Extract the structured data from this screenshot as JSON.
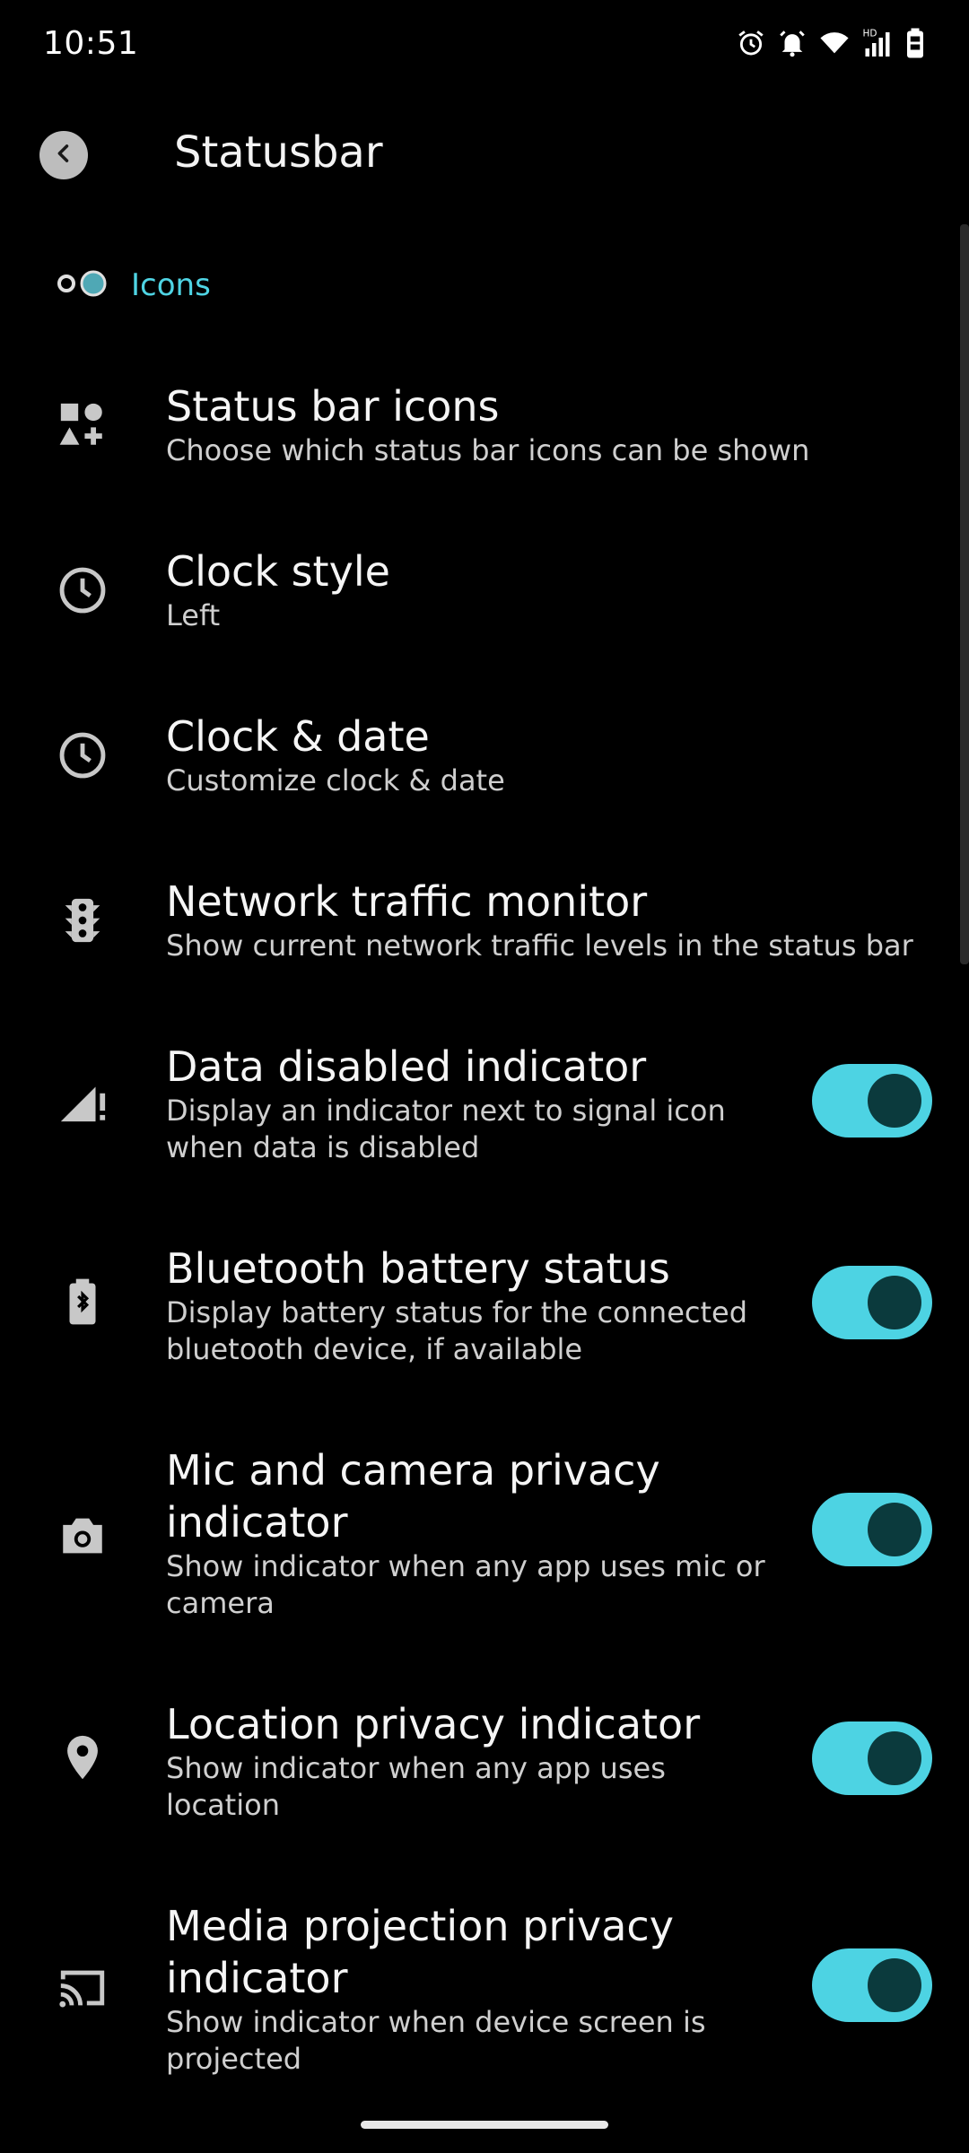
{
  "status_bar": {
    "time": "10:51",
    "icons": [
      "alarm-icon",
      "notification-bell-icon",
      "wifi-icon",
      "hd-signal-icon",
      "battery-icon"
    ]
  },
  "app_bar": {
    "title": "Statusbar",
    "back_icon": "back-arrow-icon"
  },
  "section": {
    "title": "Icons",
    "icon": "status-dots-icon",
    "accent_color": "#4fd4e4"
  },
  "preferences": [
    {
      "title": "Status bar icons",
      "summary": "Choose which status bar icons can be shown",
      "icon": "shapes-icon"
    },
    {
      "title": "Clock style",
      "summary": "Left",
      "icon": "clock-icon"
    },
    {
      "title": "Clock & date",
      "summary": "Customize clock & date",
      "icon": "clock-icon"
    },
    {
      "title": "Network traffic monitor",
      "summary": "Show current network traffic levels in the status bar",
      "icon": "traffic-light-icon"
    },
    {
      "title": "Data disabled indicator",
      "summary_lines": [
        "Display an indicator next to signal icon",
        "when data is disabled"
      ],
      "icon": "signal-alert-icon",
      "switch_on": true
    },
    {
      "title": "Bluetooth battery status",
      "summary_lines": [
        "Display battery status for the connected",
        "bluetooth device, if available"
      ],
      "icon": "bluetooth-battery-icon",
      "switch_on": true
    },
    {
      "title_lines": [
        "Mic and camera privacy",
        "indicator"
      ],
      "summary_lines": [
        "Show indicator when any app uses mic or",
        "camera"
      ],
      "icon": "camera-icon",
      "switch_on": true
    },
    {
      "title": "Location privacy indicator",
      "summary_lines": [
        "Show indicator when any app uses",
        "location"
      ],
      "icon": "location-pin-icon",
      "switch_on": true
    },
    {
      "title_lines": [
        "Media projection privacy",
        "indicator"
      ],
      "summary_lines": [
        "Show indicator when device screen is",
        "projected"
      ],
      "icon": "cast-icon",
      "switch_on": true
    }
  ],
  "colors": {
    "switch_track": "#4dd3e3",
    "switch_thumb": "#0b3a3d",
    "background": "#000000"
  }
}
